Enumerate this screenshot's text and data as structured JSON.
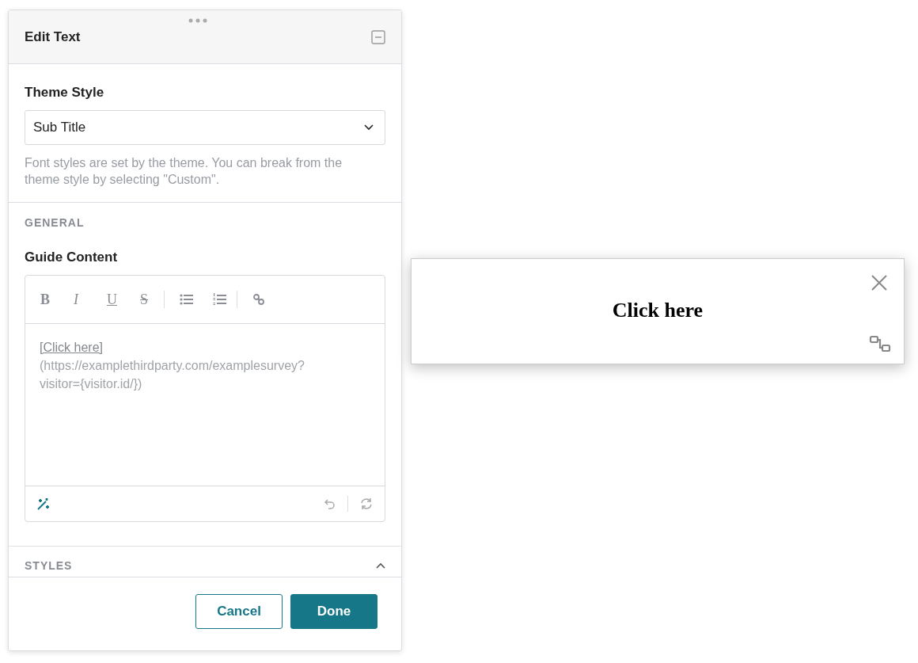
{
  "panel": {
    "title": "Edit Text",
    "theme_style": {
      "label": "Theme Style",
      "value": "Sub Title",
      "help": "Font styles are set by the theme. You can break from the theme style by selecting \"Custom\"."
    },
    "general": {
      "heading": "GENERAL",
      "label": "Guide Content",
      "toolbar": [
        {
          "kind": "bold",
          "label": "B"
        },
        {
          "kind": "italic",
          "label": "I"
        },
        {
          "kind": "underline",
          "label": "U"
        },
        {
          "kind": "strike",
          "label": "S"
        },
        {
          "kind": "separator"
        },
        {
          "kind": "bullets"
        },
        {
          "kind": "numbers"
        },
        {
          "kind": "separator"
        },
        {
          "kind": "link"
        }
      ],
      "editor": {
        "link_text": "[Click here]",
        "url_text": "(https://examplethirdparty.com/examplesurvey?visitor={visitor.id/})"
      }
    },
    "styles": {
      "heading": "STYLES",
      "expanded": true
    },
    "buttons": [
      {
        "kind": "secondary",
        "label": "Cancel"
      },
      {
        "kind": "primary",
        "label": "Done"
      }
    ]
  },
  "preview": {
    "text": "Click here"
  }
}
